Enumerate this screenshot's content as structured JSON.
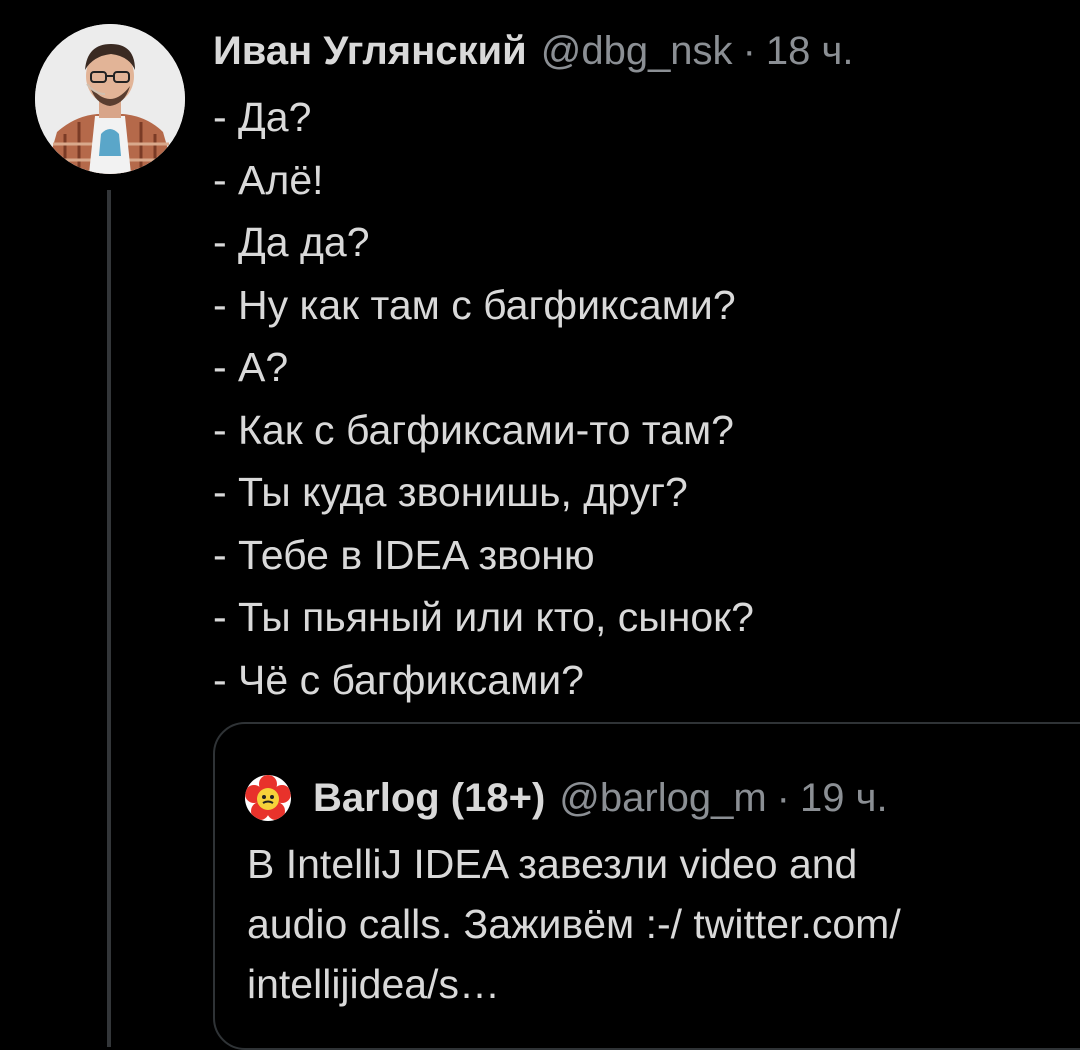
{
  "tweet": {
    "author_name": "Иван Углянский",
    "author_handle": "@dbg_nsk",
    "separator": "·",
    "timestamp": "18 ч.",
    "avatar_icon": "user-avatar-photo",
    "lines": [
      "- Да?",
      "- Алё!",
      "- Да да?",
      "- Ну как там с багфиксами?",
      "- А?",
      "- Как с багфиксами-то там?",
      "- Ты куда звонишь, друг?",
      "- Тебе в IDEA звоню",
      "- Ты пьяный или кто, сынок?",
      "- Чё с багфиксами?"
    ]
  },
  "quoted_tweet": {
    "author_name": "Barlog (18+)",
    "author_handle": "@barlog_m",
    "separator": "·",
    "timestamp": "19 ч.",
    "avatar_icon": "flower-avatar-icon",
    "lines": [
      "В IntelliJ IDEA завезли video and",
      "audio calls. Заживём :-/ twitter.com/",
      "intellijidea/s…"
    ]
  },
  "colors": {
    "background": "#000000",
    "text_primary": "#d9d9d9",
    "text_secondary": "#8b8f94",
    "border": "#2f3336",
    "thread_line": "#333639"
  }
}
